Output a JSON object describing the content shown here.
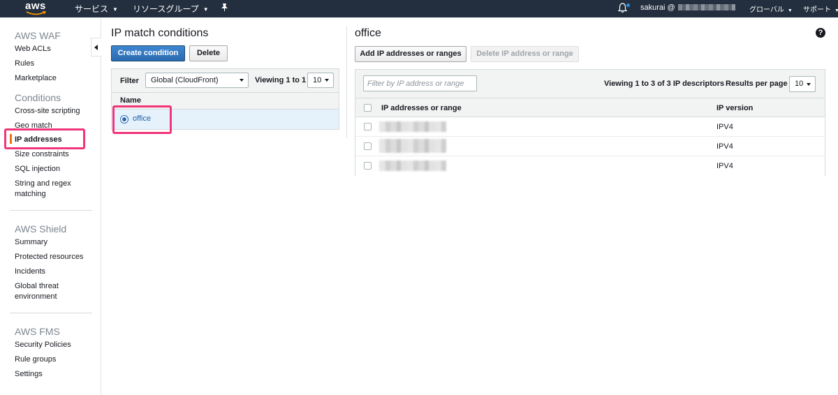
{
  "topnav": {
    "logo": "aws",
    "services": "サービス",
    "resource_groups": "リソースグループ",
    "account": "sakurai @",
    "region": "グローバル",
    "support": "サポート",
    "icons": {
      "pin": "pin-icon",
      "bell": "bell-icon"
    }
  },
  "sidebar": {
    "waf_heading": "AWS WAF",
    "waf_items": [
      "Web ACLs",
      "Rules",
      "Marketplace"
    ],
    "conditions_heading": "Conditions",
    "conditions_items": [
      "Cross-site scripting",
      "Geo match",
      "IP addresses",
      "Size constraints",
      "SQL injection",
      "String and regex",
      "matching"
    ],
    "shield_heading": "AWS Shield",
    "shield_items": [
      "Summary",
      "Protected resources",
      "Incidents",
      "Global threat",
      "environment"
    ],
    "fms_heading": "AWS FMS",
    "fms_items": [
      "Security Policies",
      "Rule groups",
      "Settings"
    ],
    "active_item": "IP addresses"
  },
  "conditions_panel": {
    "title": "IP match conditions",
    "create_button": "Create condition",
    "delete_button": "Delete",
    "filter_label": "Filter",
    "filter_value": "Global (CloudFront)",
    "viewing": "Viewing 1 to 1",
    "page_size": "10",
    "column_name": "Name",
    "rows": [
      {
        "name": "office",
        "selected": true
      }
    ]
  },
  "detail_panel": {
    "title": "office",
    "add_button": "Add IP addresses or ranges",
    "delete_button": "Delete IP address or range",
    "filter_placeholder": "Filter by IP address or range",
    "viewing": "Viewing 1 to 3 of 3 IP descriptors",
    "results_per_page_label": "Results per page",
    "results_per_page": "10",
    "columns": [
      "IP addresses or range",
      "IP version"
    ],
    "rows": [
      {
        "ip_version": "IPV4"
      },
      {
        "ip_version": "IPV4"
      },
      {
        "ip_version": "IPV4"
      }
    ]
  },
  "colors": {
    "nav_bg": "#232f3e",
    "primary": "#2e73b8",
    "highlight_annotation": "#f0357a",
    "active_accent": "#ec7211"
  }
}
